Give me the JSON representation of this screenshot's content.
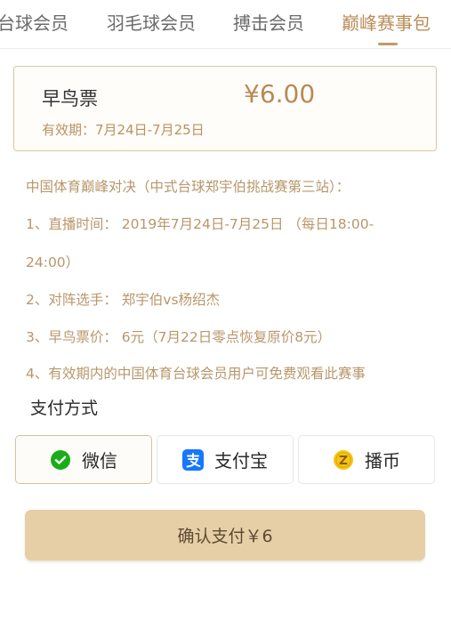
{
  "tabs": [
    {
      "label": "台球会员",
      "active": false
    },
    {
      "label": "羽毛球会员",
      "active": false
    },
    {
      "label": "搏击会员",
      "active": false
    },
    {
      "label": "巅峰赛事包",
      "active": true
    }
  ],
  "ticket": {
    "name": "早鸟票",
    "price": "¥6.00",
    "validity": "有效期：7月24日-7月25日"
  },
  "description": {
    "intro": "中国体育巅峰对决（中式台球郑宇伯挑战赛第三站）：",
    "line1a": "1、直播时间： 2019年7月24日-7月25日 （每日18:00-",
    "line1b": "24:00）",
    "line2": "2、对阵选手： 郑宇伯vs杨绍杰",
    "line3": "3、早鸟票价： 6元（7月22日零点恢复原价8元）",
    "line4": "4、有效期内的中国体育台球会员用户可免费观看此赛事"
  },
  "payment": {
    "title": "支付方式",
    "options": [
      {
        "label": "微信",
        "icon": "wechat-pay-icon",
        "selected": true
      },
      {
        "label": "支付宝",
        "icon": "alipay-icon",
        "selected": false
      },
      {
        "label": "播币",
        "icon": "bobi-coin-icon",
        "selected": false
      }
    ]
  },
  "confirm": {
    "label": "确认支付￥6"
  },
  "colors": {
    "accent": "#b98e5a",
    "ticket_border": "#dbc6a3",
    "description_text": "#b8976a",
    "confirm_bg": "#e6cfa6",
    "wechat_green": "#1aad19",
    "alipay_blue": "#1677ff",
    "coin_yellow": "#f5c518"
  }
}
